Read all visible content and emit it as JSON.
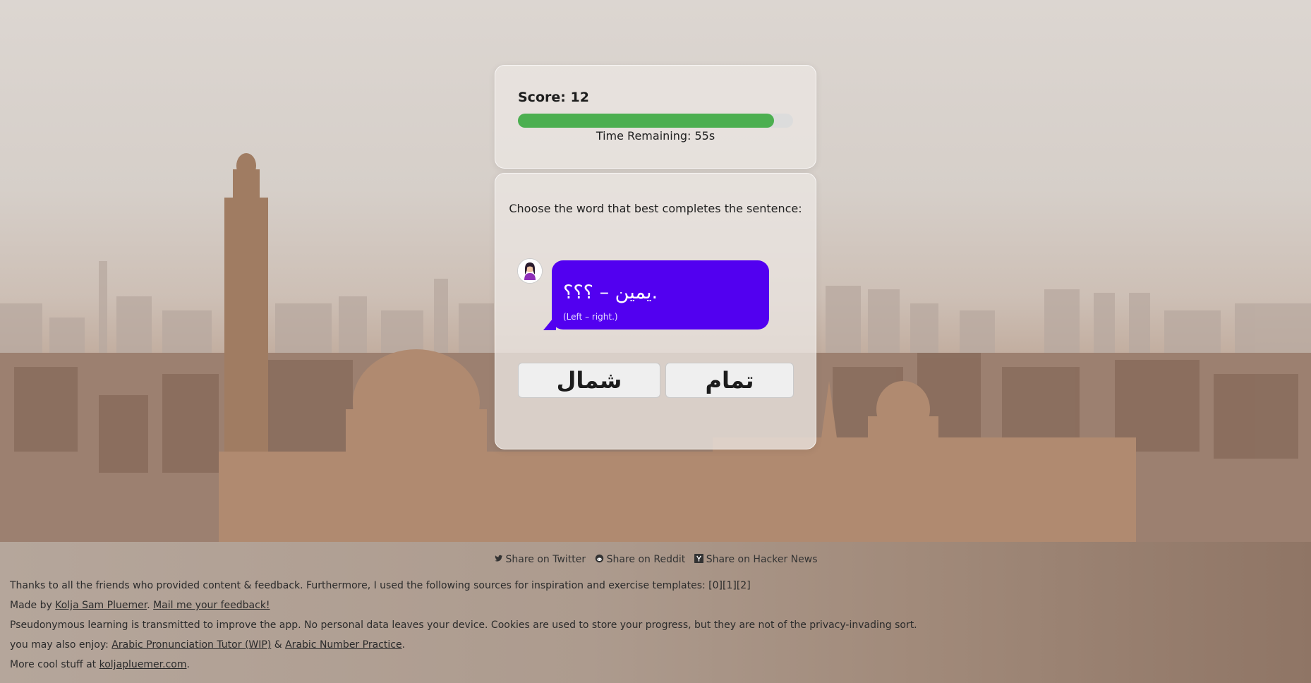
{
  "score": {
    "label": "Score: 12"
  },
  "timer": {
    "label": "Time Remaining: 55s",
    "progress_fraction": 0.93
  },
  "quiz": {
    "prompt": "Choose the word that best completes the sentence:",
    "sentence": "يمين – ؟؟؟.",
    "translation": "(Left – right.)",
    "answers": [
      "شمال",
      "تمام"
    ]
  },
  "share": {
    "twitter": "Share on Twitter",
    "reddit": "Share on Reddit",
    "hackernews": "Share on Hacker News"
  },
  "footer": {
    "thanks": "Thanks to all the friends who provided content & feedback. Furthermore, I used the following sources for inspiration and exercise templates: [0][1][2]",
    "made_by_prefix": "Made by ",
    "author": "Kolja Sam Pluemer",
    "made_by_sep": ". ",
    "mail": "Mail me your feedback!",
    "privacy": "Pseudonymous learning is transmitted to improve the app. No personal data leaves your device. Cookies are used to store your progress, but they are not of the privacy-invading sort.",
    "enjoy_prefix": "you may also enjoy: ",
    "enjoy_link1": "Arabic Pronunciation Tutor (WIP)",
    "enjoy_sep": " & ",
    "enjoy_link2": "Arabic Number Practice",
    "enjoy_end": ".",
    "more_prefix": "More cool stuff at ",
    "more_link": "koljapluemer.com",
    "more_end": "."
  },
  "colors": {
    "accent_bubble": "#5200f0",
    "progress": "#4caf50"
  }
}
